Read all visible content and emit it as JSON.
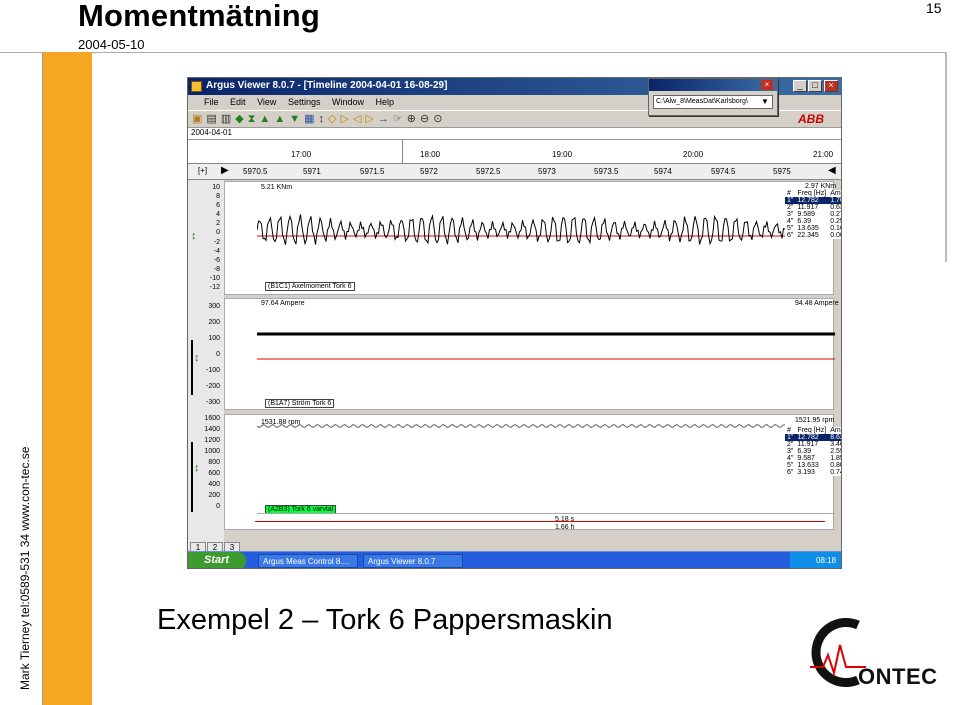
{
  "slide": {
    "title": "Momentmätning",
    "date": "2004-05-10",
    "page_number": "15",
    "side_text": "Mark Tierney tel:0589-531 34   www.con-tec.se",
    "caption": "Exempel 2 – Tork 6 Pappersmaskin",
    "logo": "ONTEC",
    "accent_color": "#f5a623"
  },
  "window": {
    "title": "Argus Viewer 8.0.7 - [Timeline 2004-04-01 16-08-29]",
    "menu": [
      "File",
      "Edit",
      "View",
      "Settings",
      "Window",
      "Help"
    ],
    "popup_path": "C:\\Alw_8\\MeasDat\\Karlsborg\\",
    "brand": "ABB",
    "timeline": {
      "date": "2004-04-01",
      "times": [
        "17:00",
        "18:00",
        "19:00",
        "20:00",
        "21:00"
      ]
    },
    "scale": {
      "ticks": [
        "5970.5",
        "5971",
        "5971.5",
        "5972",
        "5972.5",
        "5973",
        "5973.5",
        "5974",
        "5974.5",
        "5975"
      ]
    },
    "panel1": {
      "y_ticks": [
        "10",
        "8",
        "6",
        "4",
        "2",
        "0",
        "-2",
        "-4",
        "-6",
        "-8",
        "-10",
        "-12"
      ],
      "readout_left": "5.21 KNm",
      "readout_right": "2.97 KNm",
      "tag": "(B1C1) Axelmoment Tork 6",
      "table_header": [
        "#",
        "Freq [Hz]",
        "Ampl [KNm]"
      ],
      "rows": [
        [
          "1\"",
          "12.782",
          "1.701"
        ],
        [
          "2\"",
          "11.917",
          "0.63"
        ],
        [
          "3\"",
          "9.589",
          "0.271"
        ],
        [
          "4\"",
          "6.39",
          "0.251"
        ],
        [
          "5\"",
          "13.635",
          "0.166"
        ],
        [
          "6\"",
          "22.345",
          "0.062"
        ]
      ]
    },
    "panel2": {
      "y_ticks": [
        "300",
        "200",
        "100",
        "0",
        "-100",
        "-200",
        "-300"
      ],
      "readout_left": "97.64 Ampere",
      "readout_right": "94.48 Ampere",
      "tag": "(B1A7) Ström Tork 6"
    },
    "panel3": {
      "y_ticks": [
        "1600",
        "1400",
        "1200",
        "1000",
        "800",
        "600",
        "400",
        "200",
        "0"
      ],
      "readout_left": "1531.88 rpm",
      "readout_right": "1521.95 rpm",
      "tag": "(A2B3) Tork 6 varvtal",
      "table_header": [
        "#",
        "Freq [Hz]",
        "Ampl [rpm]"
      ],
      "rows": [
        [
          "1\"",
          "12.782",
          "8.627"
        ],
        [
          "2\"",
          "11.917",
          "3.46"
        ],
        [
          "3\"",
          "6.39",
          "2.598"
        ],
        [
          "4\"",
          "9.587",
          "1.853"
        ],
        [
          "5\"",
          "13.633",
          "0.807"
        ],
        [
          "6\"",
          "3.193",
          "0.741"
        ]
      ],
      "marker1": "5.18 s",
      "marker2": "1.66 h"
    },
    "tabs": [
      "1",
      "2",
      "3"
    ],
    "taskbar": {
      "start": "Start",
      "tasks": [
        "Argus Meas Control 8....",
        "Argus Viewer 8.0.7"
      ],
      "clock": "08:18"
    }
  }
}
